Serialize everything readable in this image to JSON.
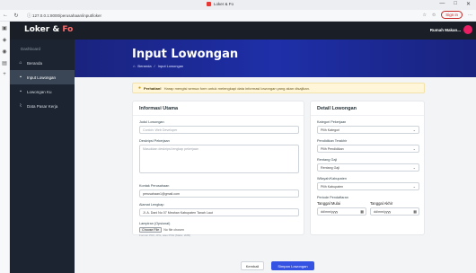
{
  "browser": {
    "tab_title": "Loker & Fo",
    "url": "127.0.0.1:8000/perusahaan/input/loker",
    "signin_label": "Sign in",
    "window_controls": [
      "—",
      "□",
      "✕"
    ]
  },
  "app": {
    "brand_prefix": "Loker & ",
    "brand_suffix": "Fo",
    "user_name": "Rumah Makan...",
    "accent_color": "#ff6b6b"
  },
  "sidebar": {
    "items": [
      {
        "label": "Dashboard",
        "icon": "none",
        "active": false
      },
      {
        "label": "Beranda",
        "icon": "home-icon",
        "active": false
      },
      {
        "label": "Input Lowongan",
        "icon": "briefcase-icon",
        "active": true
      },
      {
        "label": "Lowongan Ku",
        "icon": "briefcase-icon",
        "active": false
      },
      {
        "label": "Data Pasar Kerja",
        "icon": "chart-icon",
        "active": false
      }
    ]
  },
  "banner": {
    "title": "Input Lowongan",
    "breadcrumb": [
      "Beranda",
      "/",
      "Input Lowongan"
    ]
  },
  "warning": {
    "bold": "Perhatian!",
    "text": "Harap mengisi semua form untuk melengkapi data informasi lowongan yang akan disajikan."
  },
  "left_card": {
    "title": "Informasi Utama",
    "fields": {
      "judul": {
        "label": "Judul Lowongan",
        "placeholder": "Contoh: Web Developer"
      },
      "deskripsi": {
        "label": "Deskripsi Pekerjaan",
        "placeholder": "Masukkan deskripsi lengkap pekerjaan"
      },
      "kontak": {
        "label": "Kontak Perusahaan",
        "value": "perusahaan1@gmail.com"
      },
      "alamat": {
        "label": "Alamat Lengkap",
        "value": "Jl. A. Dani No 07 Meahan Kabupaten Tanah Laut"
      },
      "lampiran": {
        "label": "Lampiran (Opsional)",
        "button": "Choose File",
        "file_text": "No file chosen",
        "hint": "Format: PDF, JPG, atau PNG (Maks: 2MB)"
      }
    }
  },
  "right_card": {
    "title": "Detail Lowongan",
    "fields": {
      "kategori": {
        "label": "Kategori Pekerjaan",
        "value": "Pilih Kategori"
      },
      "pendidikan": {
        "label": "Pendidikan Terakhir",
        "value": "Pilih Pendidikan"
      },
      "gaji": {
        "label": "Rentang Gaji",
        "value": "Rentang Gaji"
      },
      "wilayah": {
        "label": "Wilayah/Kabupaten",
        "value": "Pilih Kabupaten"
      },
      "periode": {
        "label": "Periode Pendaftaran"
      },
      "mulai": {
        "label": "Tanggal Mulai",
        "placeholder": "dd/mm/yyyy"
      },
      "akhir": {
        "label": "Tanggal Akhir",
        "placeholder": "dd/mm/yyyy"
      }
    }
  },
  "actions": {
    "cancel": "Kembali",
    "save": "Simpan Lowongan"
  }
}
